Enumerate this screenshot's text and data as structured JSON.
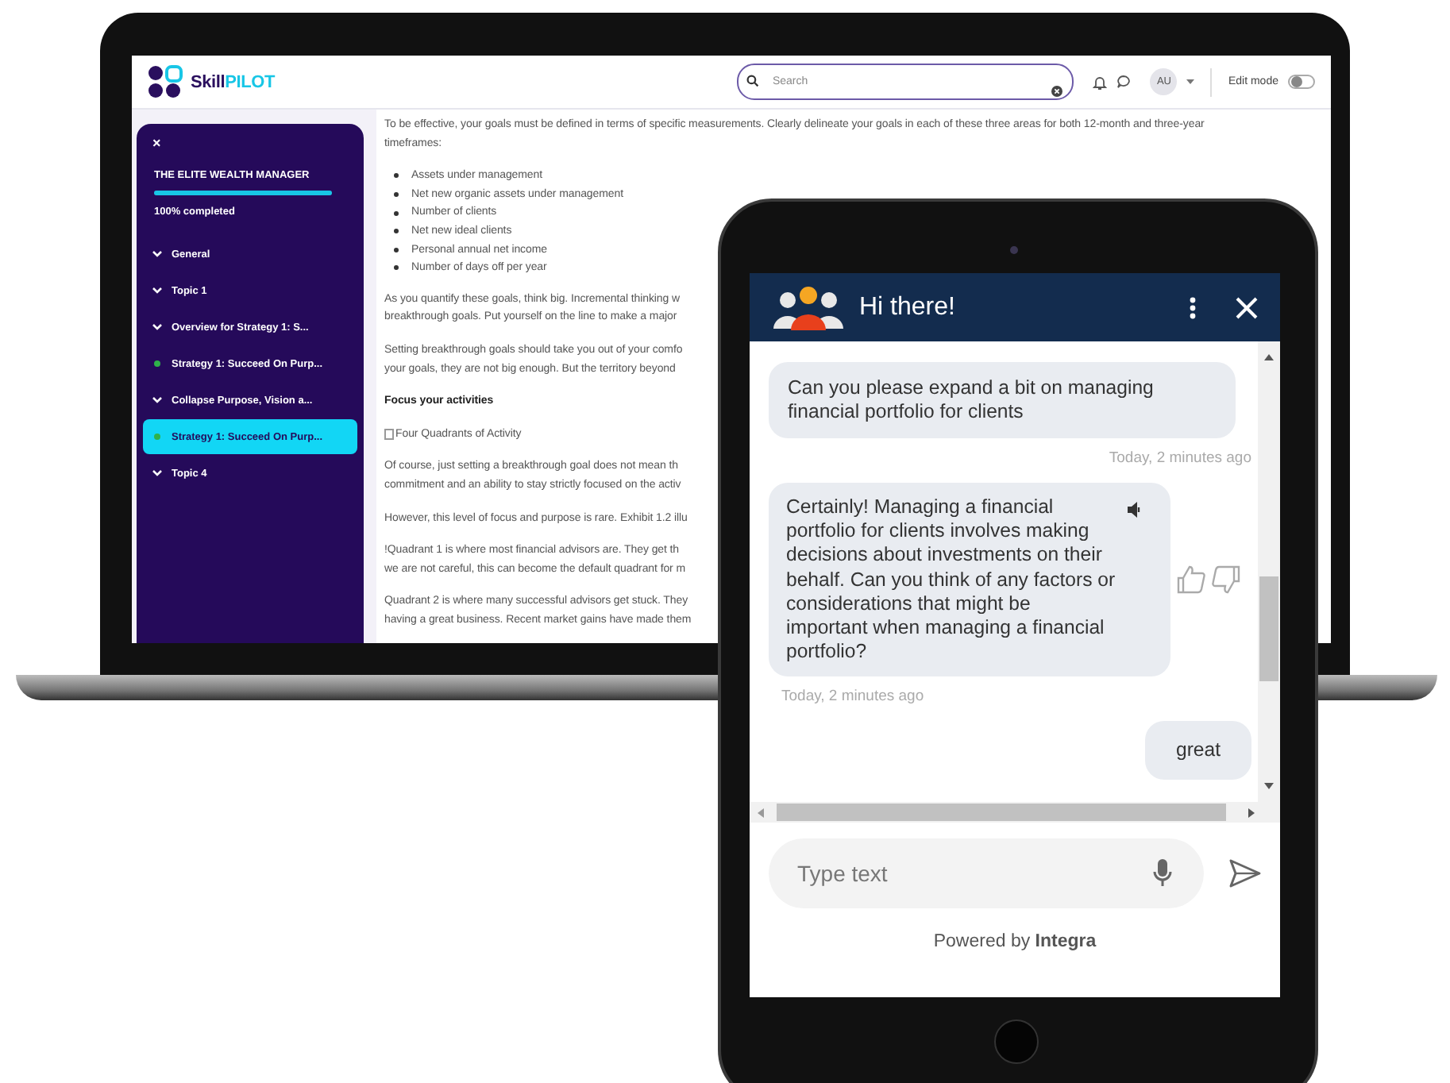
{
  "laptop": {
    "header": {
      "logo": [
        "Skill",
        "PILOT"
      ],
      "search": {
        "placeholder": "Search"
      },
      "avatar": "AU",
      "edit_mode": {
        "label": "Edit mode",
        "on": false
      }
    },
    "sidebar": {
      "close": "×",
      "course_title": "THE ELITE WEALTH MANAGER",
      "progress": {
        "level": 1.0,
        "label": "100% completed"
      },
      "items": [
        {
          "kind": "section",
          "label": "General",
          "selected": false
        },
        {
          "kind": "section",
          "label": "Topic 1",
          "selected": false
        },
        {
          "kind": "section",
          "label": "Overview for Strategy 1: S...",
          "selected": false
        },
        {
          "kind": "lesson",
          "label": "Strategy 1: Succeed On Purp...",
          "selected": false
        },
        {
          "kind": "section",
          "label": "Collapse Purpose, Vision a...",
          "selected": false
        },
        {
          "kind": "lesson",
          "label": "Strategy 1: Succeed On Purp...",
          "selected": true
        },
        {
          "kind": "section",
          "label": "Topic 4",
          "selected": false
        }
      ]
    },
    "content": [
      {
        "kind": "paragraph",
        "lines": [
          "To be effective, your goals must be defined in terms of specific measurements. Clearly delineate your goals in each of these three areas for both 12-month and three-year",
          "timeframes:"
        ]
      },
      {
        "kind": "bullets",
        "items": [
          "Assets under management",
          "Net new organic assets under management",
          "Number of clients",
          "Net new ideal clients",
          "Personal annual net income",
          "Number of days off per year"
        ]
      },
      {
        "kind": "paragraph",
        "lines": [
          "As you quantify these goals, think big. Incremental thinking w",
          "breakthrough goals. Put yourself on the line to make a major"
        ]
      },
      {
        "kind": "paragraph",
        "lines": [
          "Setting breakthrough goals should take you out of your comfo",
          "your goals, they are not big enough. But the territory beyond"
        ]
      },
      {
        "kind": "heading",
        "lines": [
          "Focus your activities"
        ]
      },
      {
        "kind": "image",
        "lines": [
          "Four Quadrants of Activity"
        ]
      },
      {
        "kind": "paragraph",
        "lines": [
          "Of course, just setting a breakthrough goal does not mean th",
          "commitment and an ability to stay strictly focused on the activ"
        ]
      },
      {
        "kind": "paragraph",
        "lines": [
          "However, this level of focus and purpose is rare. Exhibit 1.2 illu"
        ]
      },
      {
        "kind": "paragraph",
        "lines": [
          "!Quadrant 1 is where most financial advisors are. They get th",
          "we are not careful, this can become the default quadrant for m"
        ]
      },
      {
        "kind": "paragraph",
        "lines": [
          "Quadrant 2 is where many successful advisors get stuck. They",
          "having a great business. Recent market gains have made them"
        ]
      }
    ]
  },
  "chat": {
    "title": "Hi there!",
    "messages": [
      {
        "kind": "question",
        "text": "Can you please expand a bit on managing financial portfolio for clients",
        "time": "Today, 2 minutes ago"
      },
      {
        "kind": "answer",
        "text": "Certainly! Managing a financial portfolio for clients involves making decisions about investments on their behalf. Can you think of any factors or considerations that might be important when managing a financial portfolio?",
        "time": "Today, 2 minutes ago"
      },
      {
        "kind": "reply",
        "text": "great"
      }
    ],
    "input": {
      "placeholder": "Type text"
    },
    "footer": "Powered by **Integra**"
  }
}
